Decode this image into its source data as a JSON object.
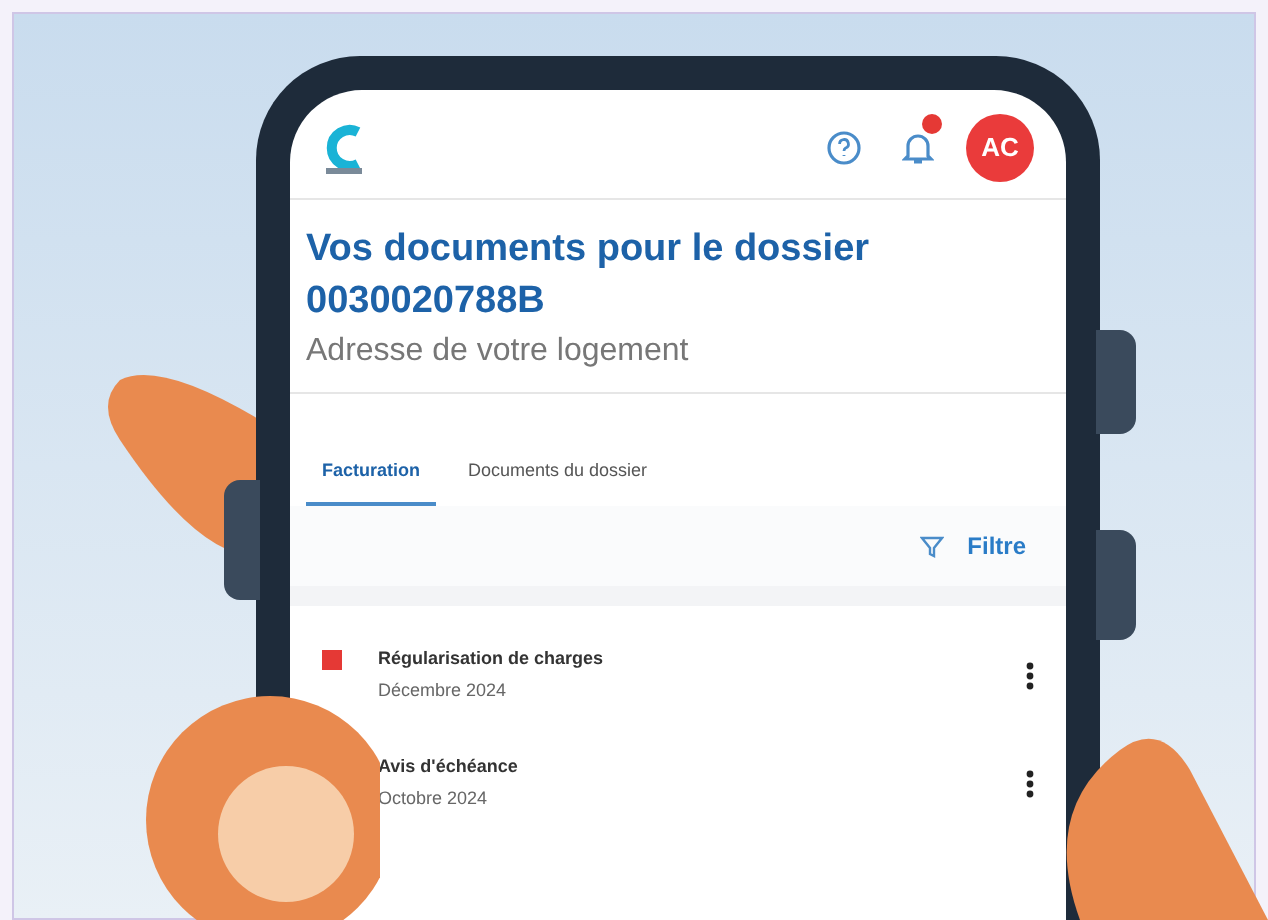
{
  "header": {
    "avatar": "AC",
    "notification_badge": true
  },
  "title": [
    "Vos documents pour le dossier",
    "0030020788B"
  ],
  "subtitle": "Adresse de votre logement",
  "tabs": [
    {
      "label": "Facturation",
      "selected": true
    },
    {
      "label": "Documents du dossier",
      "selected": false
    }
  ],
  "filter": "Filtre",
  "documents": [
    {
      "kind": "flagged",
      "title": "Régularisation de charges",
      "date": "Décembre 2024"
    },
    {
      "kind": "plain",
      "title": "Avis d'échéance",
      "date": "Octobre 2024"
    }
  ]
}
